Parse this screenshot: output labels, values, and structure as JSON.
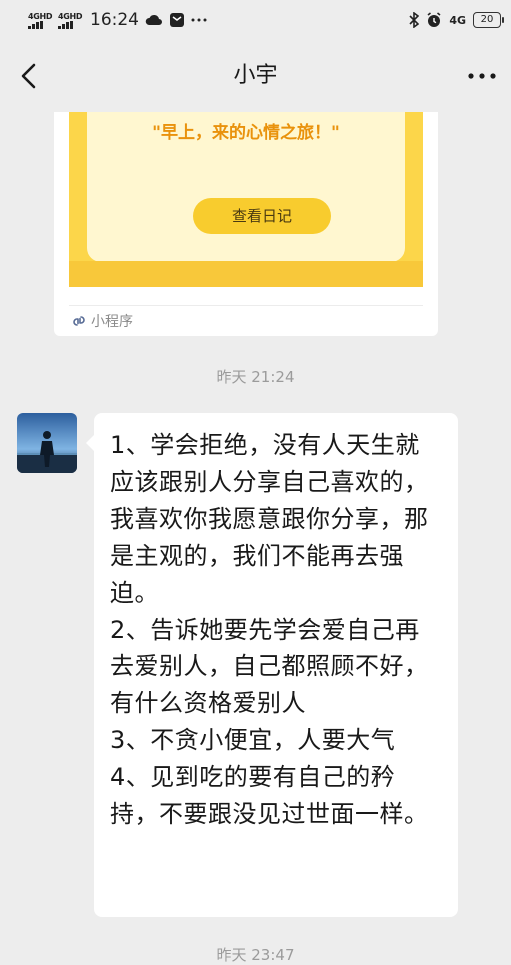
{
  "status_bar": {
    "signal1": "4GHD",
    "signal2": "4GHD",
    "time": "16:24",
    "network": "4G",
    "battery": "20",
    "icons": [
      "cloud-icon",
      "message-icon",
      "more-dots-icon",
      "bluetooth-icon",
      "alarm-icon"
    ]
  },
  "header": {
    "title": "小宇",
    "icons": [
      "back-arrow-icon",
      "more-icon"
    ]
  },
  "mini_program": {
    "quote": "\"早上，来的心情之旅！\"",
    "button_label": "查看日记",
    "source_label": "小程序",
    "accent": "#fcd64a"
  },
  "messages": [
    {
      "timestamp": "昨天 21:24",
      "text": "1、学会拒绝，没有人天生就应该跟别人分享自己喜欢的，我喜欢你我愿意跟你分享，那是主观的，我们不能再去强迫。\n2、告诉她要先学会爱自己再去爱别人，自己都照顾不好，有什么资格爱别人\n3、不贪小便宜，人要大气\n4、见到吃的要有自己的矜持，不要跟没见过世面一样。"
    }
  ],
  "next_timestamp": "昨天 23:47"
}
